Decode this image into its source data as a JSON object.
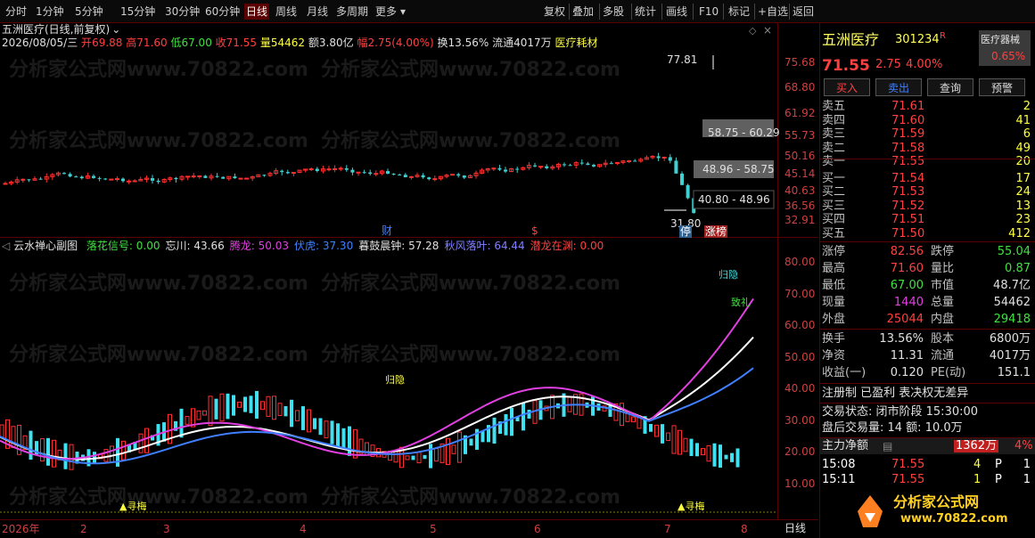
{
  "toolbar": {
    "left_items": [
      "分时",
      "1分钟",
      "5分钟",
      "15分钟",
      "30分钟",
      "60分钟",
      "日线",
      "周线",
      "月线",
      "多周期",
      "更多"
    ],
    "right_items": [
      "复权",
      "叠加",
      "多股",
      "统计",
      "画线",
      "F10",
      "标记",
      "+自选",
      "返回"
    ],
    "active": "日线"
  },
  "main_chart": {
    "title": "五洲医疗(日线,前复权)",
    "info_date": "2026/08/05/三",
    "info_open_label": "开",
    "info_open": "69.88",
    "info_high_label": "高",
    "info_high": "71.60",
    "info_low_label": "低",
    "info_low": "67.00",
    "info_close_label": "收",
    "info_close": "71.55",
    "info_vol_label": "量",
    "info_vol": "54462",
    "info_amt_label": "额",
    "info_amt": "3.80亿",
    "info_chg_label": "幅",
    "info_chg": "2.75(4.00%)",
    "info_turn_label": "换",
    "info_turn": "13.56%",
    "info_float_label": "流通",
    "info_float": "4017万",
    "info_sector": "医疗耗材",
    "y_ticks": [
      "75.68",
      "68.80",
      "61.92",
      "55.73",
      "50.16",
      "45.14",
      "40.63",
      "36.56",
      "32.91"
    ],
    "high_mark": "77.81",
    "low_mark": "31.80",
    "chip_ranges": [
      "58.75 - 60.29",
      "48.96 - 58.75",
      "40.80 - 48.96"
    ],
    "markers": [
      "财",
      "$",
      "停",
      "涨榜"
    ]
  },
  "sub_chart": {
    "title": "云水禅心副图",
    "legend": [
      {
        "label": "落花信号:",
        "value": "0.00",
        "color": "#40e040"
      },
      {
        "label": "忘川:",
        "value": "43.66",
        "color": "#e0e0e0"
      },
      {
        "label": "腾龙:",
        "value": "50.03",
        "color": "#e040e0"
      },
      {
        "label": "伏虎:",
        "value": "37.30",
        "color": "#4080ff"
      },
      {
        "label": "暮鼓晨钟:",
        "value": "57.28",
        "color": "#e0e0e0"
      },
      {
        "label": "秋风落叶:",
        "value": "64.44",
        "color": "#8080ff"
      },
      {
        "label": "潜龙在渊:",
        "value": "0.00",
        "color": "#ff4040"
      }
    ],
    "y_ticks": [
      "80.00",
      "70.00",
      "60.00",
      "50.00",
      "40.00",
      "30.00",
      "20.00",
      "10.00"
    ],
    "signals": [
      "归隐",
      "归隐",
      "致礼",
      "寻梅",
      "寻梅"
    ],
    "x_ticks": [
      "2026年",
      "2",
      "3",
      "4",
      "5",
      "6",
      "7",
      "8"
    ],
    "period": "日线"
  },
  "quote": {
    "name": "五洲医疗",
    "code": "301234",
    "flag": "R",
    "sector_label": "医疗器械",
    "sector_chg": "0.65%",
    "price": "71.55",
    "chg": "2.75",
    "chg_pct": "4.00%",
    "buttons": [
      "买入",
      "卖出",
      "查询",
      "预警"
    ],
    "asks": [
      {
        "label": "卖五",
        "price": "71.61",
        "vol": "2"
      },
      {
        "label": "卖四",
        "price": "71.60",
        "vol": "41"
      },
      {
        "label": "卖三",
        "price": "71.59",
        "vol": "6"
      },
      {
        "label": "卖二",
        "price": "71.58",
        "vol": "49"
      },
      {
        "label": "卖一",
        "price": "71.55",
        "vol": "20"
      }
    ],
    "bids": [
      {
        "label": "买一",
        "price": "71.54",
        "vol": "17"
      },
      {
        "label": "买二",
        "price": "71.53",
        "vol": "24"
      },
      {
        "label": "买三",
        "price": "71.52",
        "vol": "13"
      },
      {
        "label": "买四",
        "price": "71.51",
        "vol": "23"
      },
      {
        "label": "买五",
        "price": "71.50",
        "vol": "412"
      }
    ],
    "stats": [
      {
        "l1": "涨停",
        "v1": "82.56",
        "c1": "#ff4040",
        "l2": "跌停",
        "v2": "55.04",
        "c2": "#40e040"
      },
      {
        "l1": "最高",
        "v1": "71.60",
        "c1": "#ff4040",
        "l2": "量比",
        "v2": "0.87",
        "c2": "#40e040"
      },
      {
        "l1": "最低",
        "v1": "67.00",
        "c1": "#40e040",
        "l2": "市值",
        "v2": "48.7亿",
        "c2": "#e0e0e0"
      },
      {
        "l1": "现量",
        "v1": "1440",
        "c1": "#e040e0",
        "l2": "总量",
        "v2": "54462",
        "c2": "#e0e0e0"
      },
      {
        "l1": "外盘",
        "v1": "25044",
        "c1": "#ff4040",
        "l2": "内盘",
        "v2": "29418",
        "c2": "#40e040"
      }
    ],
    "stats2": [
      {
        "l1": "换手",
        "v1": "13.56%",
        "l2": "股本",
        "v2": "6800万"
      },
      {
        "l1": "净资",
        "v1": "11.31",
        "l2": "流通",
        "v2": "4017万"
      },
      {
        "l1": "收益(一)",
        "v1": "0.120",
        "l2": "PE(动)",
        "v2": "151.1"
      }
    ],
    "reg_note": "注册制 已盈利 表决权无差异",
    "trade_status": "交易状态: 闭市阶段 15:30:00",
    "after_hours": "盘后交易量: 14  额: 10.0万",
    "main_flow_label": "主力净额",
    "main_flow": "1362万",
    "main_flow_pct": "4%",
    "ticks": [
      {
        "time": "15:08",
        "price": "71.55",
        "vol": "4",
        "dir": "P",
        "n": "1"
      },
      {
        "time": "15:11",
        "price": "71.55",
        "vol": "1",
        "dir": "P",
        "n": "1"
      }
    ],
    "brand_text": "分析家公式网",
    "brand_url": "www.70822.com"
  },
  "watermark": "分析家公式网www.70822.com"
}
